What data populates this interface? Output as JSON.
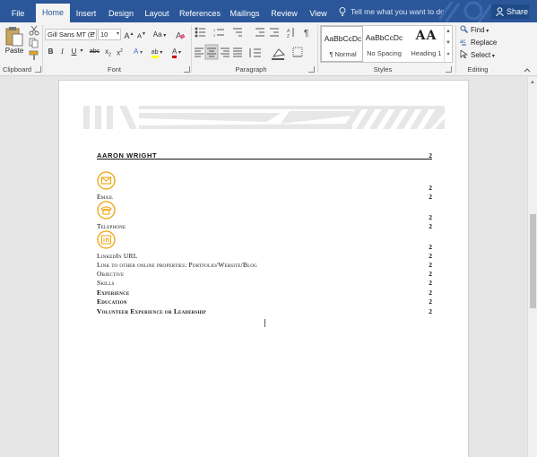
{
  "tabs": [
    {
      "label": "File",
      "active": false
    },
    {
      "label": "Home",
      "active": true
    },
    {
      "label": "Insert",
      "active": false
    },
    {
      "label": "Design",
      "active": false
    },
    {
      "label": "Layout",
      "active": false
    },
    {
      "label": "References",
      "active": false
    },
    {
      "label": "Mailings",
      "active": false
    },
    {
      "label": "Review",
      "active": false
    },
    {
      "label": "View",
      "active": false
    }
  ],
  "tell_me": "Tell me what you want to do",
  "share_label": "Share",
  "clipboard": {
    "paste_label": "Paste",
    "group_label": "Clipboard"
  },
  "font": {
    "family": "Gill Sans MT (E",
    "size": "10",
    "grow": "A",
    "shrink": "A",
    "change_case": "Aa",
    "bold": "B",
    "italic": "I",
    "underline": "U",
    "strike": "abc",
    "subscript": "x",
    "superscript": "x",
    "text_effects": "A",
    "highlight": "ab",
    "font_color": "A",
    "group_label": "Font"
  },
  "paragraph": {
    "group_label": "Paragraph"
  },
  "styles": {
    "items": [
      {
        "sample": "AaBbCcDc",
        "name": "¶ Normal",
        "selected": true
      },
      {
        "sample": "AaBbCcDc",
        "name": "No Spacing",
        "selected": false
      },
      {
        "sample": "AA",
        "name": "Heading 1",
        "selected": false
      }
    ],
    "group_label": "Styles"
  },
  "editing": {
    "find": "Find",
    "replace": "Replace",
    "select": "Select",
    "group_label": "Editing"
  },
  "colors": {
    "accent": "#2b579a",
    "icon_gold": "#f0a30a",
    "highlight": "#ffff00",
    "font_red": "#d00000"
  },
  "document": {
    "toc": {
      "title": "AARON WRIGHT",
      "title_page": "2",
      "entries": [
        {
          "text": "",
          "page": "2"
        },
        {
          "text": "Email",
          "page": "2"
        },
        {
          "text": "",
          "page": "2"
        },
        {
          "text": "Telephone",
          "page": "2"
        },
        {
          "text": "",
          "page": "2"
        },
        {
          "text": "LinkedIn URL",
          "page": "2"
        },
        {
          "text": "Link to other online properties: Portfolio/Website/Blog",
          "page": "2"
        },
        {
          "text": "Objective",
          "page": "2"
        },
        {
          "text": "Skills",
          "page": "2"
        },
        {
          "text": "Experience",
          "page": "2",
          "bold": true
        },
        {
          "text": "Education",
          "page": "2",
          "bold": true
        },
        {
          "text": "Volunteer Experience or Leadership",
          "page": "2",
          "bold": true
        }
      ]
    },
    "icons": [
      "email-icon",
      "telephone-icon",
      "linkedin-icon"
    ]
  }
}
